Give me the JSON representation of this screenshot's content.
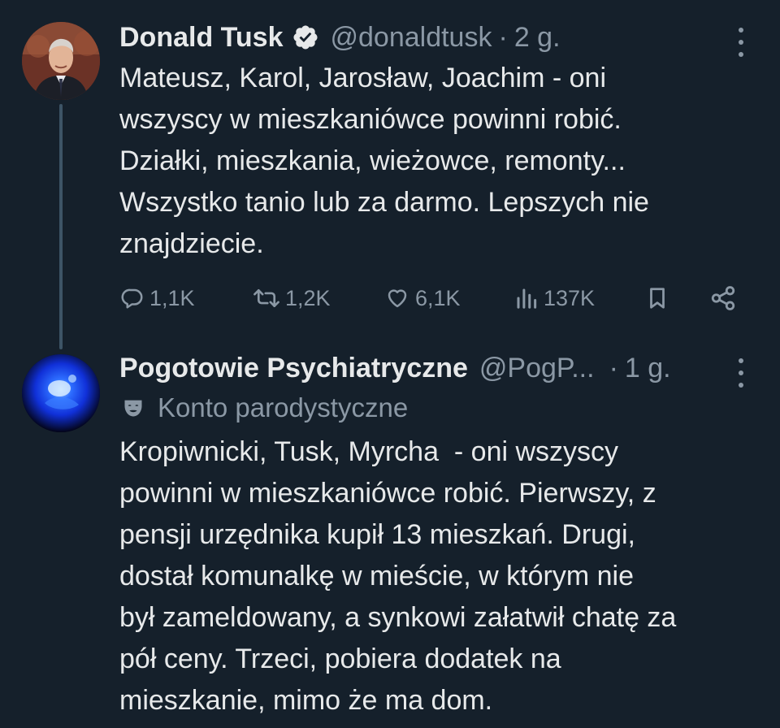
{
  "tweets": [
    {
      "author_name": "Donald Tusk",
      "verified": true,
      "handle": "@donaldtusk",
      "separator": "·",
      "time": "2 g.",
      "text": "Mateusz, Karol, Jarosław, Joachim - oni\nwszyscy w mieszkaniówce powinni robić.\nDziałki, mieszkania, wieżowce, remonty...\nWszystko tanio lub za darmo. Lepszych nie\nznajdziecie.",
      "stats": {
        "replies": "1,1K",
        "retweets": "1,2K",
        "likes": "6,1K",
        "views": "137K"
      }
    },
    {
      "author_name": "Pogotowie Psychiatryczne",
      "handle": "@PogP...",
      "separator": "·",
      "time": "1 g.",
      "account_label": "Konto parodystyczne",
      "text": "Kropiwnicki, Tusk, Myrcha  - oni wszyscy\npowinni w mieszkaniówce robić. Pierwszy, z\npensji urzędnika kupił 13 mieszkań. Drugi,\ndostał komunalkę w mieście, w którym nie\nbył zameldowany, a synkowi załatwił chatę za\npół ceny. Trzeci, pobiera dodatek na\nmieszkanie, mimo że ma dom."
    }
  ],
  "icons": {
    "verified": "verified-badge-icon",
    "more": "more-options-icon",
    "reply": "reply-icon",
    "retweet": "retweet-icon",
    "like": "like-icon",
    "views": "views-icon",
    "bookmark": "bookmark-icon",
    "share": "share-icon",
    "parody": "parody-mask-icon"
  },
  "colors": {
    "background": "#15202b",
    "text": "#e7e9ea",
    "secondary": "#8b98a5",
    "thread_line": "#3d5466"
  }
}
